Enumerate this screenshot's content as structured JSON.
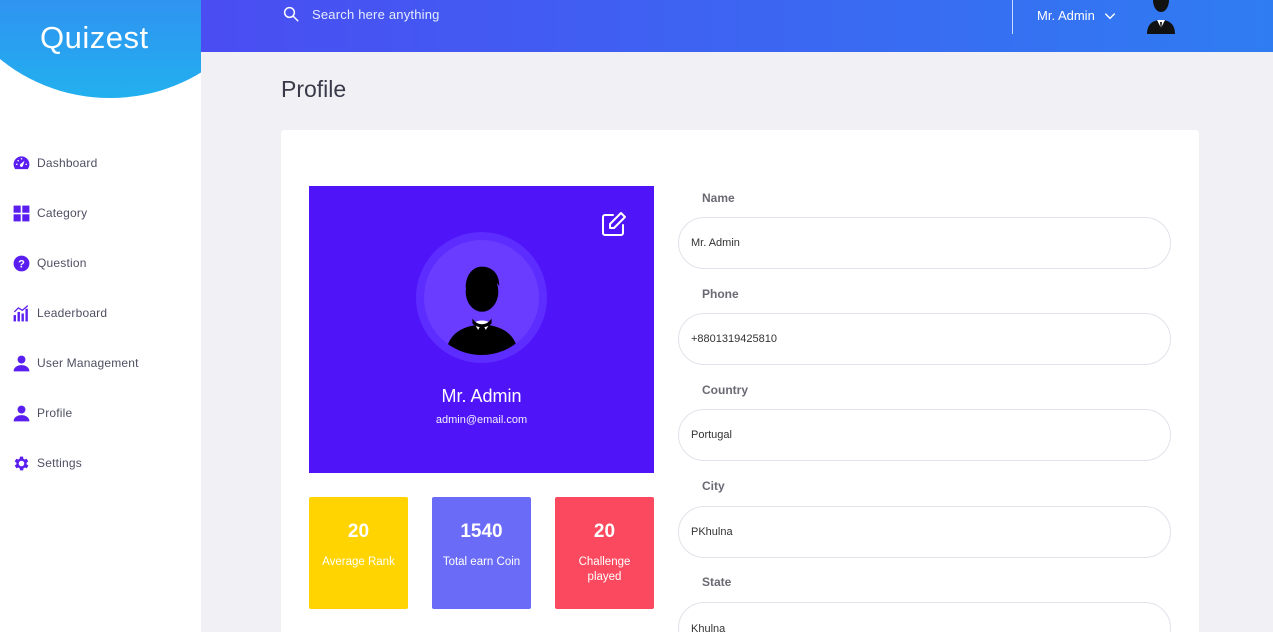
{
  "app": {
    "logo_text": "Quizest"
  },
  "colors": {
    "primary": "#5014f8",
    "topbar_start": "#4a4df2",
    "topbar_end": "#2f7cf2",
    "stat_yellow": "#ffd400",
    "stat_purple": "#6a6bf7",
    "stat_red": "#fb4a5f"
  },
  "sidebar": {
    "items": [
      {
        "label": "Dashboard",
        "icon": "dashboard-gauge-icon"
      },
      {
        "label": "Category",
        "icon": "grid-icon"
      },
      {
        "label": "Question",
        "icon": "question-circle-icon"
      },
      {
        "label": "Leaderboard",
        "icon": "bar-chart-icon"
      },
      {
        "label": "User Management",
        "icon": "user-icon"
      },
      {
        "label": "Profile",
        "icon": "user-icon"
      },
      {
        "label": "Settings",
        "icon": "gear-icon"
      }
    ]
  },
  "topbar": {
    "search_placeholder": "Search here anything",
    "user_name": "Mr. Admin"
  },
  "page": {
    "title": "Profile"
  },
  "profile": {
    "name": "Mr. Admin",
    "email": "admin@email.com"
  },
  "stats": [
    {
      "value": "20",
      "caption": "Average Rank"
    },
    {
      "value": "1540",
      "caption": "Total earn Coin"
    },
    {
      "value": "20",
      "caption": "Challenge played"
    }
  ],
  "form": {
    "fields": [
      {
        "label": "Name",
        "value": "Mr. Admin"
      },
      {
        "label": "Phone",
        "value": "+8801319425810"
      },
      {
        "label": "Country",
        "value": "Portugal"
      },
      {
        "label": "City",
        "value": "PKhulna"
      },
      {
        "label": "State",
        "value": "Khulna"
      }
    ]
  }
}
